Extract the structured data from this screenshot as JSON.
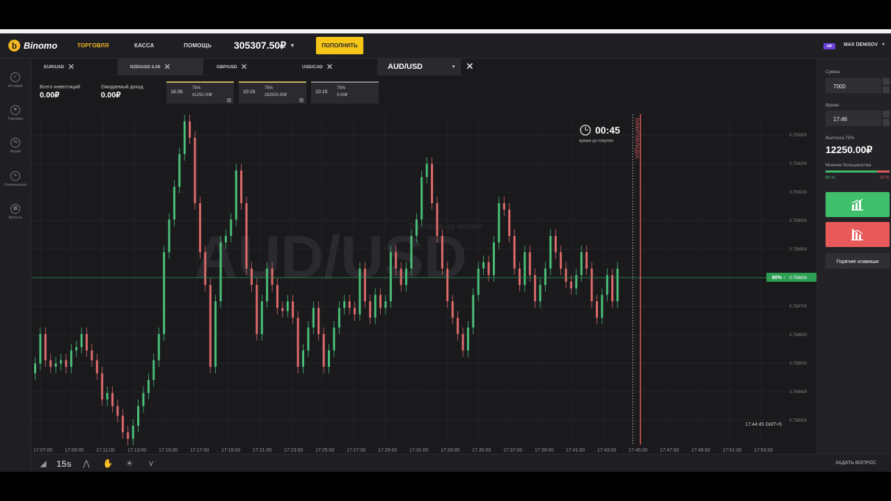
{
  "header": {
    "logo_text": "Binomo",
    "nav": [
      "ТОРГОВЛЯ",
      "КАССА",
      "ПОМОЩЬ"
    ],
    "balance": "305307.50₽",
    "deposit_label": "ПОПОЛНИТЬ",
    "vip_badge": "VIP",
    "username": "MAX DENISOV"
  },
  "sidebar": {
    "items": [
      "История",
      "Турниры",
      "Акции",
      "Оповещения",
      "Бонусы"
    ]
  },
  "tabs": [
    {
      "label": "EUR/USD"
    },
    {
      "label": "NZD/USD 0.00"
    },
    {
      "label": "GBP/USD"
    },
    {
      "label": "USD/CAD"
    }
  ],
  "asset_select": "AUD/USD",
  "stats": {
    "invest_label": "Всего инвестиций",
    "invest_value": "0.00₽",
    "income_label": "Ожидаемый доход",
    "income_value": "0.00₽"
  },
  "deals": [
    {
      "time": "16:35",
      "pct": "75%",
      "amount": "41250.00₽"
    },
    {
      "time": "10:16",
      "pct": "75%",
      "amount": "262500.00₽"
    },
    {
      "time": "10:15",
      "pct": "75%",
      "amount": "0.00₽"
    }
  ],
  "timer": {
    "value": "00:45",
    "label": "время до покупки"
  },
  "chart_data": {
    "type": "candlestick",
    "watermark": "AUD/USD",
    "watermark_sub": "Торговля на активе",
    "purchase_label": "ЛИМИТ/ИКЛАДКА",
    "price_badge": "80% ↑",
    "current_price": "0.758800",
    "y_ticks": [
      "0.759300",
      "0.759200",
      "0.759100",
      "0.759000",
      "0.758900",
      "0.758800",
      "0.758700",
      "0.758600",
      "0.758500",
      "0.758400",
      "0.758300"
    ],
    "x_ticks": [
      "17:07:00",
      "17:09:00",
      "17:11:00",
      "17:13:00",
      "17:15:00",
      "17:17:00",
      "17:19:00",
      "17:21:00",
      "17:23:00",
      "17:25:00",
      "17:27:00",
      "17:29:00",
      "17:31:00",
      "17:33:00",
      "17:35:00",
      "17:37:00",
      "17:39:00",
      "17:41:00",
      "17:43:00",
      "17:45:00",
      "17:47:00",
      "17:49:00",
      "17:51:00",
      "17:53:00"
    ],
    "server_time": "17:44:45 GMT+5",
    "ylim": [
      0.75826,
      0.75934
    ],
    "close_series": [
      0.75851,
      0.7586,
      0.75852,
      0.7585,
      0.75851,
      0.75852,
      0.7585,
      0.75855,
      0.75856,
      0.7586,
      0.75855,
      0.75852,
      0.75848,
      0.7584,
      0.75842,
      0.75838,
      0.75835,
      0.7583,
      0.75828,
      0.75832,
      0.75838,
      0.75842,
      0.75846,
      0.75852,
      0.7586,
      0.75885,
      0.75895,
      0.75905,
      0.75915,
      0.75925,
      0.7592,
      0.759,
      0.75885,
      0.75875,
      0.7585,
      0.7587,
      0.75888,
      0.7589,
      0.75895,
      0.7591,
      0.759,
      0.7588,
      0.75875,
      0.7586,
      0.7587,
      0.7588,
      0.75875,
      0.75868,
      0.75867,
      0.7587,
      0.75865,
      0.7585,
      0.75855,
      0.75862,
      0.75868,
      0.7586,
      0.7585,
      0.75855,
      0.75862,
      0.75868,
      0.7587,
      0.75868,
      0.75866,
      0.7588,
      0.7587,
      0.75865,
      0.75872,
      0.75868,
      0.7587,
      0.75885,
      0.7588,
      0.75875,
      0.7588,
      0.7589,
      0.75895,
      0.75908,
      0.75912,
      0.759,
      0.7589,
      0.7588,
      0.7587,
      0.75865,
      0.7586,
      0.75855,
      0.75862,
      0.75872,
      0.7588,
      0.75882,
      0.75878,
      0.75888,
      0.759,
      0.75898,
      0.7589,
      0.7588,
      0.75875,
      0.75885,
      0.75878,
      0.7587,
      0.75875,
      0.7588,
      0.7589,
      0.75885,
      0.7588,
      0.75876,
      0.75874,
      0.75878,
      0.75885,
      0.7588,
      0.7587,
      0.75865,
      0.75872,
      0.75878,
      0.7587,
      0.7588
    ]
  },
  "right_panel": {
    "amount_label": "Сумма",
    "amount_value": "7000",
    "time_label": "Время",
    "time_value": "17:46",
    "payout_label": "Выплата 75%",
    "payout_value": "12250.00₽",
    "sentiment_label": "Мнение большинства",
    "sentiment_up": "80 %",
    "sentiment_down": "20 %",
    "hotkeys_label": "Горячие клавиши"
  },
  "bottombar": {
    "timeframe": "15s",
    "ask_label": "ЗАДАТЬ ВОПРОС"
  }
}
